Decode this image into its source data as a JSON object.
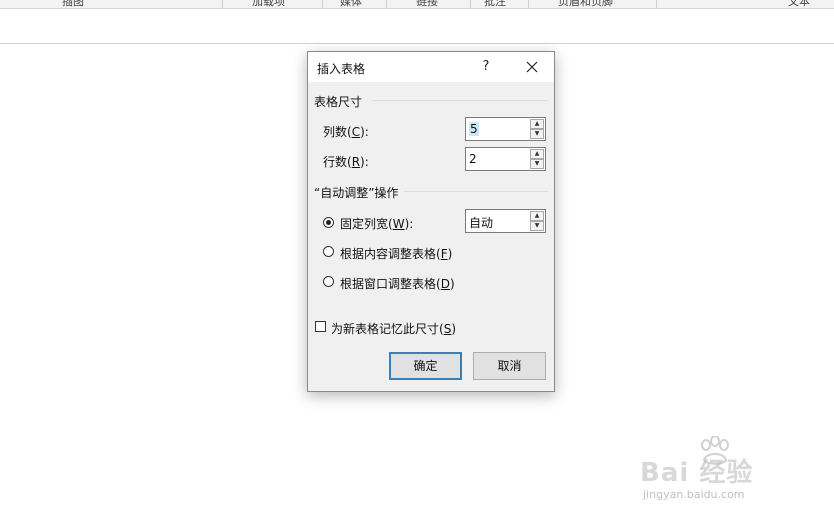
{
  "ribbon": {
    "groups": [
      "插图",
      "加载项",
      "媒体",
      "链接",
      "批注",
      "页眉和页脚",
      "文本"
    ]
  },
  "dialog": {
    "title": "插入表格",
    "help_glyph": "?",
    "close_glyph": "×",
    "table_size": {
      "label": "表格尺寸",
      "columns": {
        "label": "列数(",
        "mnemonic": "C",
        "suffix": "):",
        "value": "5"
      },
      "rows": {
        "label": "行数(",
        "mnemonic": "R",
        "suffix": "):",
        "value": "2"
      }
    },
    "autofit": {
      "label": "“自动调整”操作",
      "fixed": {
        "label": "固定列宽(",
        "mnemonic": "W",
        "suffix": "):",
        "value": "自动",
        "selected": true
      },
      "content": {
        "label": "根据内容调整表格(",
        "mnemonic": "F",
        "suffix": ")",
        "selected": false
      },
      "window": {
        "label": "根据窗口调整表格(",
        "mnemonic": "D",
        "suffix": ")",
        "selected": false
      }
    },
    "remember": {
      "label": "为新表格记忆此尺寸(",
      "mnemonic": "S",
      "suffix": ")",
      "checked": false
    },
    "ok_label": "确定",
    "cancel_label": "取消"
  },
  "watermark": {
    "brand": "Bai  经验",
    "url": "jingyan.baidu.com"
  },
  "icons": {
    "help": "help-icon",
    "close": "close-icon",
    "spin_up": "spin-up-icon",
    "spin_down": "spin-down-icon",
    "watermark": "paw-logo-icon"
  },
  "colors": {
    "primary_border": "#3c7fb1",
    "dialog_bg": "#f0f0f0",
    "selection": "#cde6f7"
  }
}
